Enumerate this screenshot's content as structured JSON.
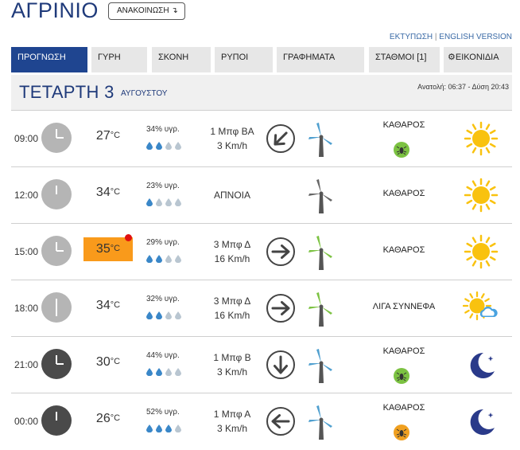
{
  "header": {
    "city": "ΑΓΡΙΝΙΟ",
    "announcement_button": "ΑΝΑΚΟΙΝΩΣΗ ↴",
    "print_link": "ΕΚΤΥΠΩΣΗ",
    "separator": "|",
    "english_link": "ENGLISH VERSION"
  },
  "tabs": [
    {
      "label": "ΠΡΟΓΝΩΣΗ",
      "active": true
    },
    {
      "label": "ΓΥΡΗ",
      "active": false
    },
    {
      "label": "ΣΚΟΝΗ",
      "active": false
    },
    {
      "label": "ΡΥΠΟΙ",
      "active": false
    },
    {
      "label": "ΓΡΑΦΗΜΑΤΑ",
      "active": false
    },
    {
      "label": "ΣΤΑΘΜΟΙ [1]",
      "active": false
    },
    {
      "label": "ΕΙΚΟΝΙΔΙΑ",
      "active": false,
      "icon": "gear-icon"
    }
  ],
  "day": {
    "name": "ΤΕΤΑΡΤΗ 3",
    "month": "ΑΥΓΟΥΣΤΟΥ",
    "sun_times": "Ανατολή: 06:37 - Δύση 20:43"
  },
  "colors": {
    "brand": "#1f4590",
    "hot_temp": "#f99a1b",
    "hot_dot": "#e01010",
    "drop_filled": "#3a87c8",
    "drop_empty": "#b9c6d1",
    "turbine_blue": "#4f9fcf",
    "turbine_green": "#7cc242",
    "pollen_green": "#7cc242",
    "pollen_orange": "#f0a020",
    "sun": "#f9c20f",
    "moon": "#2a3a8a"
  },
  "temp_unit": "°C",
  "forecast": [
    {
      "time": "09:00",
      "clock": "day",
      "clock_hour": 9,
      "temp": "27",
      "hot": false,
      "humidity": "34% υγρ.",
      "drops_filled": 2,
      "drops_total": 4,
      "wind_line1": "1 Μπφ ΒΑ",
      "wind_line2": "3 Km/h",
      "wind_arrow": "arrow-southwest",
      "arrow_rotation_deg": 225,
      "turbine": "blue",
      "sky": "ΚΑΘΑΡΟΣ",
      "pollen": "green",
      "weather_icon": "sun-icon"
    },
    {
      "time": "12:00",
      "clock": "day",
      "clock_hour": 12,
      "temp": "34",
      "hot": false,
      "humidity": "23% υγρ.",
      "drops_filled": 1,
      "drops_total": 4,
      "wind_line1": "ΑΠΝΟΙΑ",
      "wind_line2": "",
      "wind_arrow": "",
      "arrow_rotation_deg": null,
      "turbine": "gray",
      "sky": "ΚΑΘΑΡΟΣ",
      "pollen": "",
      "weather_icon": "sun-icon"
    },
    {
      "time": "15:00",
      "clock": "day",
      "clock_hour": 3,
      "temp": "35",
      "hot": true,
      "humidity": "29% υγρ.",
      "drops_filled": 2,
      "drops_total": 4,
      "wind_line1": "3 Μπφ Δ",
      "wind_line2": "16 Km/h",
      "wind_arrow": "arrow-east",
      "arrow_rotation_deg": 90,
      "turbine": "green",
      "sky": "ΚΑΘΑΡΟΣ",
      "pollen": "",
      "weather_icon": "sun-icon"
    },
    {
      "time": "18:00",
      "clock": "day",
      "clock_hour": 6,
      "temp": "34",
      "hot": false,
      "humidity": "32% υγρ.",
      "drops_filled": 2,
      "drops_total": 4,
      "wind_line1": "3 Μπφ Δ",
      "wind_line2": "16 Km/h",
      "wind_arrow": "arrow-east",
      "arrow_rotation_deg": 90,
      "turbine": "green",
      "sky": "ΛΙΓΑ ΣΥΝΝΕΦΑ",
      "pollen": "",
      "weather_icon": "sun-cloud-icon"
    },
    {
      "time": "21:00",
      "clock": "night",
      "clock_hour": 9,
      "temp": "30",
      "hot": false,
      "humidity": "44% υγρ.",
      "drops_filled": 2,
      "drops_total": 4,
      "wind_line1": "1 Μπφ Β",
      "wind_line2": "3 Km/h",
      "wind_arrow": "arrow-south",
      "arrow_rotation_deg": 180,
      "turbine": "blue",
      "sky": "ΚΑΘΑΡΟΣ",
      "pollen": "green",
      "weather_icon": "moon-icon"
    },
    {
      "time": "00:00",
      "clock": "night",
      "clock_hour": 12,
      "temp": "26",
      "hot": false,
      "humidity": "52% υγρ.",
      "drops_filled": 3,
      "drops_total": 4,
      "wind_line1": "1 Μπφ Α",
      "wind_line2": "3 Km/h",
      "wind_arrow": "arrow-west",
      "arrow_rotation_deg": 270,
      "turbine": "blue",
      "sky": "ΚΑΘΑΡΟΣ",
      "pollen": "orange",
      "weather_icon": "moon-icon"
    }
  ]
}
